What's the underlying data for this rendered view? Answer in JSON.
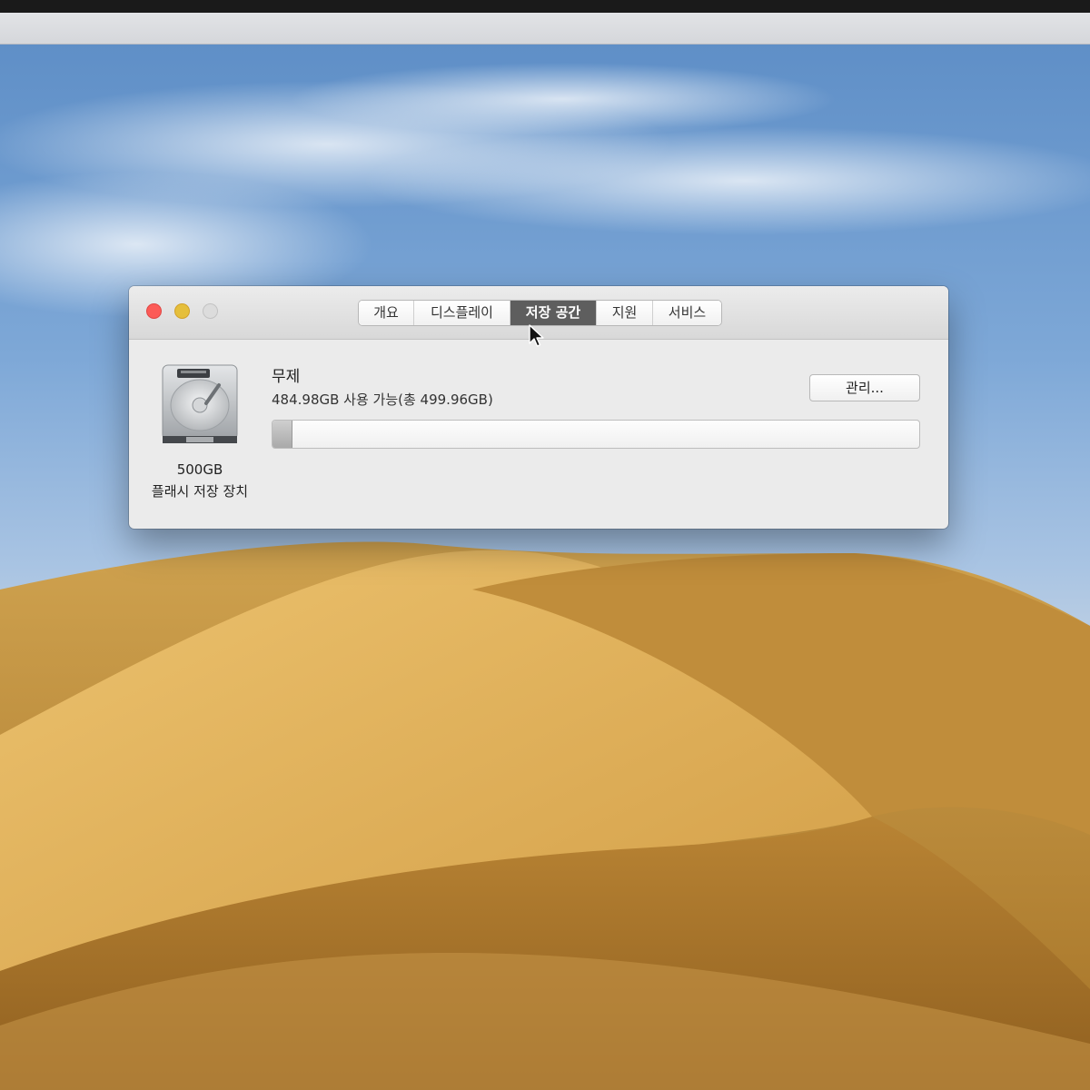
{
  "window": {
    "tabs": [
      {
        "label": "개요",
        "active": false
      },
      {
        "label": "디스플레이",
        "active": false
      },
      {
        "label": "저장 공간",
        "active": true
      },
      {
        "label": "지원",
        "active": false
      },
      {
        "label": "서비스",
        "active": false
      }
    ]
  },
  "storage": {
    "drive": {
      "icon": "hard-drive-icon",
      "size": "500GB",
      "type": "플래시 저장 장치"
    },
    "volume": {
      "name": "무제",
      "info": "484.98GB 사용 가능(총 499.96GB)",
      "used_fraction": 0.03
    },
    "manage_label": "관리..."
  },
  "colors": {
    "close": "#fc5b57",
    "minimize": "#e5bf3c",
    "zoom": "#dcdcdc",
    "active_tab": "#5e5e5e"
  }
}
